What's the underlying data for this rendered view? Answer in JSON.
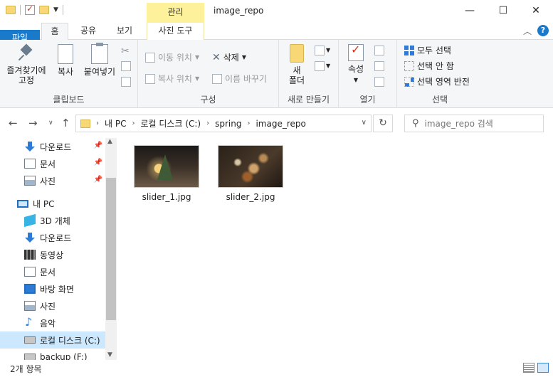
{
  "window": {
    "title": "image_repo",
    "manage_tab": "관리",
    "controls": {
      "minimize": "—",
      "maximize": "☐",
      "close": "✕"
    }
  },
  "ribbon_tabs": [
    "파일",
    "홈",
    "공유",
    "보기",
    "사진 도구"
  ],
  "ribbon": {
    "clipboard": {
      "pin_quick": "즐겨찾기에\n고정",
      "copy": "복사",
      "paste": "붙여넣기",
      "label": "클립보드"
    },
    "organize": {
      "move_to": "이동 위치",
      "copy_to": "복사 위치",
      "delete": "삭제",
      "rename": "이름 바꾸기",
      "label": "구성"
    },
    "new": {
      "new_folder": "새\n폴더",
      "label": "새로 만들기"
    },
    "open": {
      "properties": "속성",
      "label": "열기"
    },
    "select": {
      "select_all": "모두 선택",
      "select_none": "선택 안 함",
      "invert": "선택 영역 반전",
      "label": "선택"
    }
  },
  "address": {
    "crumbs": [
      "내 PC",
      "로컬 디스크 (C:)",
      "spring",
      "image_repo"
    ]
  },
  "search": {
    "placeholder": "image_repo 검색"
  },
  "nav": {
    "quick": [
      {
        "label": "다운로드",
        "icon": "download-icon",
        "pinned": true
      },
      {
        "label": "문서",
        "icon": "document-icon",
        "pinned": true
      },
      {
        "label": "사진",
        "icon": "pictures-icon",
        "pinned": true
      }
    ],
    "this_pc": "내 PC",
    "pc_items": [
      {
        "label": "3D 개체",
        "icon": "3d-objects-icon"
      },
      {
        "label": "다운로드",
        "icon": "download-icon"
      },
      {
        "label": "동영상",
        "icon": "video-icon"
      },
      {
        "label": "문서",
        "icon": "document-icon"
      },
      {
        "label": "바탕 화면",
        "icon": "desktop-icon"
      },
      {
        "label": "사진",
        "icon": "pictures-icon"
      },
      {
        "label": "음악",
        "icon": "music-icon"
      },
      {
        "label": "로컬 디스크 (C:)",
        "icon": "drive-icon",
        "selected": true
      },
      {
        "label": "backup (F:)",
        "icon": "drive-icon"
      }
    ]
  },
  "files": [
    {
      "name": "slider_1.jpg"
    },
    {
      "name": "slider_2.jpg"
    }
  ],
  "status": {
    "count": "2개 항목"
  }
}
